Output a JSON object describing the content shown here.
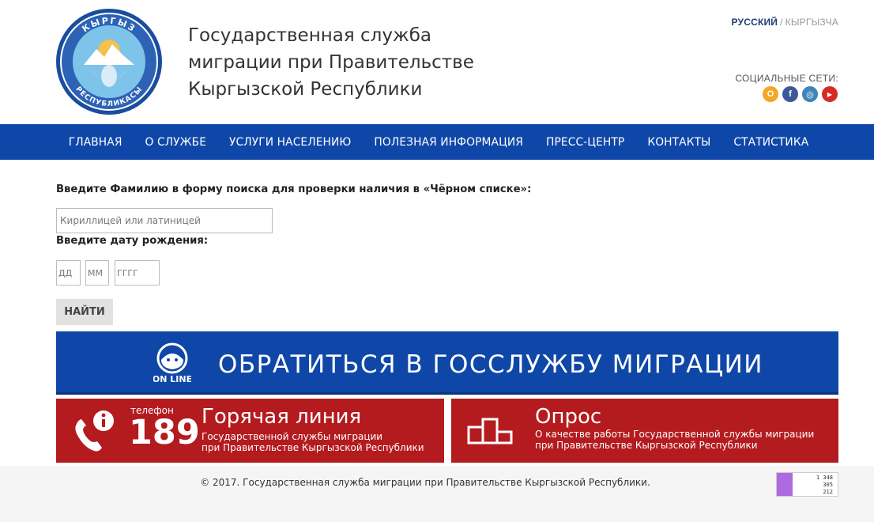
{
  "header": {
    "title_line1": "Государственная служба",
    "title_line2": "миграции при Правительстве",
    "title_line3": "Кыргызской Республики",
    "emblem_top_text": "КЫРГЫЗ",
    "emblem_bottom_text": "РЕСПУБЛИКАСЫ",
    "lang_active": "РУССКИЙ",
    "lang_separator": "/",
    "lang_other": "КЫРГЫЗЧА",
    "social_label": "СОЦИАЛЬНЫЕ СЕТИ:",
    "social_icons": [
      "odnoklassniki-icon",
      "facebook-icon",
      "instagram-icon",
      "youtube-icon"
    ],
    "social_glyphs": [
      "О",
      "f",
      "◎",
      "▶"
    ]
  },
  "nav": {
    "items": [
      "ГЛАВНАЯ",
      "О СЛУЖБЕ",
      "УСЛУГИ НАСЕЛЕНИЮ",
      "ПОЛЕЗНАЯ ИНФОРМАЦИЯ",
      "ПРЕСС-ЦЕНТР",
      "КОНТАКТЫ",
      "СТАТИСТИКА"
    ]
  },
  "search": {
    "title": "Введите Фамилию в форму поиска для проверки наличия в «Чёрном списке»:",
    "surname_placeholder": "Кириллицей или латиницей",
    "dob_title": "Введите дату рождения:",
    "day_placeholder": "ДД",
    "month_placeholder": "ММ",
    "year_placeholder": "ГГГГ",
    "find_label": "НАЙТИ"
  },
  "banner": {
    "online_label": "ON LINE",
    "text": "ОБРАТИТЬСЯ В ГОССЛУЖБУ МИГРАЦИИ"
  },
  "hotline": {
    "phone_label": "телефон",
    "phone_number": "189",
    "title": "Горячая линия",
    "sub1": "Государственной службы миграции",
    "sub2": "при Правительстве Кыргызской Республики"
  },
  "poll": {
    "title": "Опрос",
    "sub1": "О качестве работы Государственной службы миграции",
    "sub2": "при Правительстве Кыргызской Республики"
  },
  "footer": {
    "copyright": "© 2017. Государственная служба миграции при Правительстве Кыргызской Республики.",
    "counter_values": [
      "1 348",
      "305",
      "212"
    ]
  },
  "colors": {
    "primary_blue": "#0f47a8",
    "tile_red": "#b41b1f"
  }
}
